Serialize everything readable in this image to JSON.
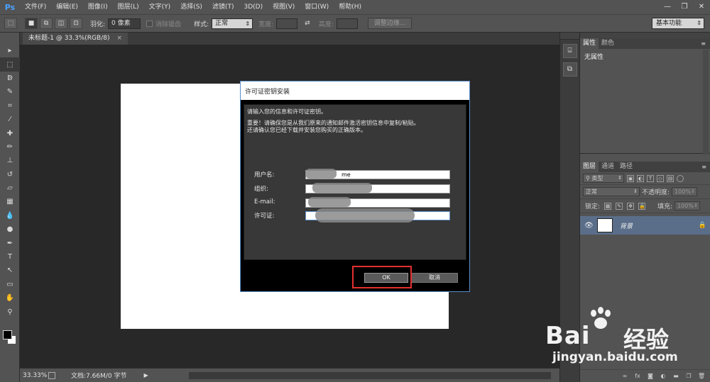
{
  "app": {
    "logo": "Ps",
    "menu": [
      "文件(F)",
      "编辑(E)",
      "图像(I)",
      "图层(L)",
      "文字(Y)",
      "选择(S)",
      "滤镜(T)",
      "3D(D)",
      "视图(V)",
      "窗口(W)",
      "帮助(H)"
    ]
  },
  "options": {
    "feather_label": "羽化:",
    "feather_value": "0 像素",
    "antialias_label": "消除锯齿",
    "style_label": "样式:",
    "style_value": "正常",
    "width_label": "宽度:",
    "height_label": "高度:",
    "refine_edge": "调整边缘...",
    "workspace": "基本功能"
  },
  "document": {
    "tab_title": "未标题-1 @ 33.3%(RGB/8)",
    "tab_close": "×"
  },
  "status": {
    "zoom": "33.33%",
    "doc_info": "文档:7.66M/0 字节"
  },
  "panels": {
    "props_tabs": [
      "属性",
      "颜色"
    ],
    "props_body": "无属性",
    "layers_tabs": [
      "图层",
      "通道",
      "路径"
    ],
    "filter_kind": "类型",
    "blend_mode": "正常",
    "opacity_label": "不透明度:",
    "opacity_value": "100%",
    "lock_label": "锁定:",
    "fill_label": "填充:",
    "fill_value": "100%",
    "layer_name": "背景"
  },
  "dialog": {
    "title": "许可证密钥安装",
    "prompt": "请输入您的信息和许可证密钥。",
    "note_line1": "重要！请确保您是从我们原来的通知邮件激活密钥信息中复制/粘贴。",
    "note_line2": "还请确认您已经下载并安装您购买的正确版本。",
    "username_label": "用户名:",
    "org_label": "组织:",
    "email_label": "E-mail:",
    "license_label": "许可证:",
    "username_value": "me",
    "ok": "OK",
    "cancel": "取消"
  },
  "watermark": {
    "brand": "Bai",
    "brand2": "经验",
    "url": "jingyan.baidu.com"
  }
}
